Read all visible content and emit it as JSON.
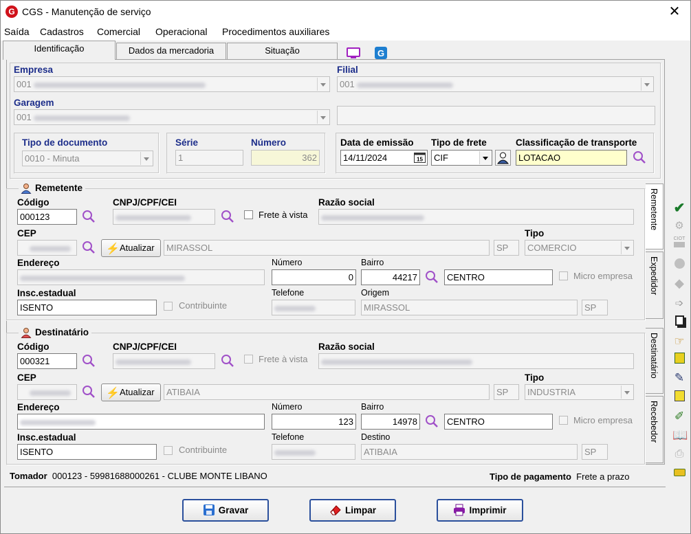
{
  "window": {
    "title": "CGS - Manutenção de serviço",
    "logo_letter": "G"
  },
  "menu": [
    "Saída",
    "Cadastros",
    "Comercial",
    "Operacional",
    "Procedimentos auxiliares"
  ],
  "tabs": [
    "Identificação",
    "Dados da mercadoria",
    "Situação"
  ],
  "side_tabs": [
    "Remetente",
    "Expedidor",
    "Destinatário",
    "Recebedor"
  ],
  "header": {
    "empresa_label": "Empresa",
    "empresa_value": "001",
    "filial_label": "Filial",
    "filial_value": "001",
    "garagem_label": "Garagem",
    "garagem_value": "001",
    "tipo_doc_label": "Tipo de documento",
    "tipo_doc_value": "0010 - Minuta",
    "serie_label": "Série",
    "serie_value": "1",
    "numero_label": "Número",
    "numero_value": "362",
    "data_emissao_label": "Data de emissão",
    "data_emissao_value": "14/11/2024",
    "calendar_day": "15",
    "tipo_frete_label": "Tipo de frete",
    "tipo_frete_value": "CIF",
    "classif_label": "Classificação de transporte",
    "classif_value": "LOTACAO"
  },
  "remetente": {
    "title": "Remetente",
    "codigo_label": "Código",
    "codigo_value": "000123",
    "cnpj_label": "CNPJ/CPF/CEI",
    "frete_vista_label": "Frete à vista",
    "razao_label": "Razão social",
    "cep_label": "CEP",
    "atualizar_label": "Atualizar",
    "cidade_value": "MIRASSOL",
    "uf_value": "SP",
    "tipo_label": "Tipo",
    "tipo_value": "COMERCIO",
    "endereco_label": "Endereço",
    "numero_label": "Número",
    "numero_value": "0",
    "bairro_label": "Bairro",
    "bairro_code": "44217",
    "bairro_value": "CENTRO",
    "micro_label": "Micro empresa",
    "insc_label": "Insc.estadual",
    "insc_value": "ISENTO",
    "contribuinte_label": "Contribuinte",
    "telefone_label": "Telefone",
    "origem_label": "Origem",
    "origem_value": "MIRASSOL",
    "origem_uf": "SP"
  },
  "destinatario": {
    "title": "Destinatário",
    "codigo_label": "Código",
    "codigo_value": "000321",
    "cnpj_label": "CNPJ/CPF/CEI",
    "frete_vista_label": "Frete à vista",
    "razao_label": "Razão social",
    "cep_label": "CEP",
    "atualizar_label": "Atualizar",
    "cidade_value": "ATIBAIA",
    "uf_value": "SP",
    "tipo_label": "Tipo",
    "tipo_value": "INDUSTRIA",
    "endereco_label": "Endereço",
    "numero_label": "Número",
    "numero_value": "123",
    "bairro_label": "Bairro",
    "bairro_code": "14978",
    "bairro_value": "CENTRO",
    "micro_label": "Micro empresa",
    "insc_label": "Insc.estadual",
    "insc_value": "ISENTO",
    "contribuinte_label": "Contribuinte",
    "telefone_label": "Telefone",
    "destino_label": "Destino",
    "destino_value": "ATIBAIA",
    "destino_uf": "SP"
  },
  "footer": {
    "tomador_label": "Tomador",
    "tomador_value": "000123 - 59981688000261 - CLUBE MONTE LIBANO",
    "pagamento_label": "Tipo de pagamento",
    "pagamento_value": "Frete a prazo"
  },
  "buttons": {
    "gravar": "Gravar",
    "limpar": "Limpar",
    "imprimir": "Imprimir"
  },
  "toolbar_ciot": "CIOT",
  "colors": {
    "label_blue": "#1c2d8a",
    "highlight_yellow": "#ffffcc",
    "search_purple": "#a050c8",
    "button_border": "#2a4f9c"
  }
}
